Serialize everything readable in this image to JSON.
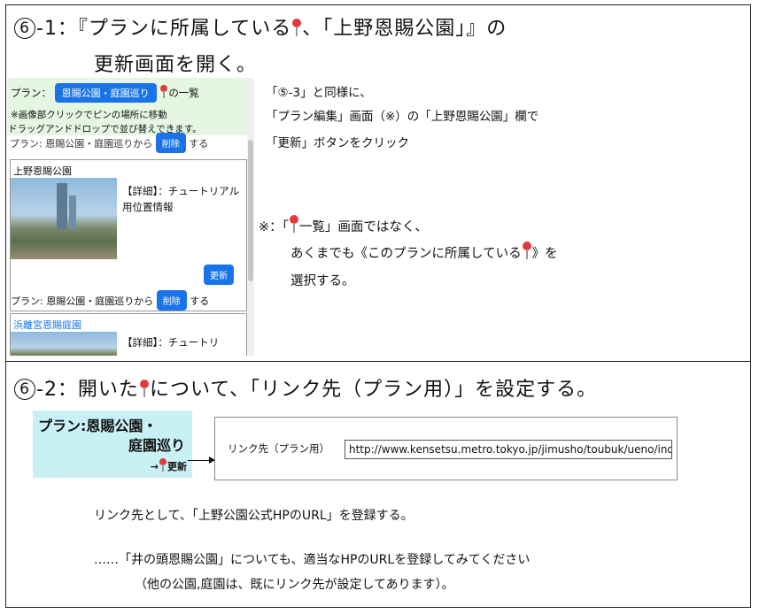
{
  "section1": {
    "number": "6",
    "heading_prefix": "-1：『プランに所属している",
    "heading_suffix": "、「上野恩賜公園」』の",
    "heading_line2": "更新画面を開く。"
  },
  "screenshot": {
    "plan_label": "プラン：",
    "plan_badge": "恩賜公園・庭園巡り",
    "list_suffix": "の一覧",
    "hint1": "※画像部クリックでピンの場所に移動",
    "hint2": "ドラッグアンドドロップで並び替えできます。",
    "row_partial": "プラン: 恩賜公園・庭園巡りから",
    "delete_btn": "削除",
    "suru": "する",
    "card1_title": "上野恩賜公園",
    "detail_label": "【詳細】：チュートリアル用位置情報",
    "update_btn": "更新",
    "card1_plan": "プラン: 恩賜公園・庭園巡りから",
    "card2_title": "浜離宮恩賜庭園",
    "card2_detail": "【詳細】：チュートリ"
  },
  "notes": {
    "line1": "「⑤-3」と同様に、",
    "line2": "「プラン編集」画面（※）の「上野恩賜公園」欄で",
    "line3": "「更新」ボタンをクリック",
    "remark_prefix": "※：「",
    "remark_suffix": "一覧」画面ではなく、",
    "remark2_prefix": "あくまでも《このプランに所属している",
    "remark2_suffix": "》を",
    "remark3": "選択する。"
  },
  "section2": {
    "number": "6",
    "heading_prefix": "-2：開いた",
    "heading_suffix": "について、「リンク先（プラン用）」を設定する。",
    "plan_title_line1": "プラン:恩賜公園・",
    "plan_title_line2": "庭園巡り",
    "update_link": "→",
    "update_text": "更新",
    "link_label": "リンク先（プラン用）",
    "link_value": "http://www.kensetsu.metro.tokyo.jp/jimusho/toubuk/ueno/index.html",
    "body1": "リンク先として、「上野公園公式HPのURL」を登録する。",
    "body2": "……「井の頭恩賜公園」についても、適当なHPのURLを登録してみてください",
    "body3": "（他の公園,庭園は、既にリンク先が設定してあります）。"
  },
  "colors": {
    "accent_blue": "#1a73e8",
    "pin_red": "#e23b3b",
    "green_bg": "#e5f7e2",
    "cyan_bg": "#c9f0f5"
  }
}
